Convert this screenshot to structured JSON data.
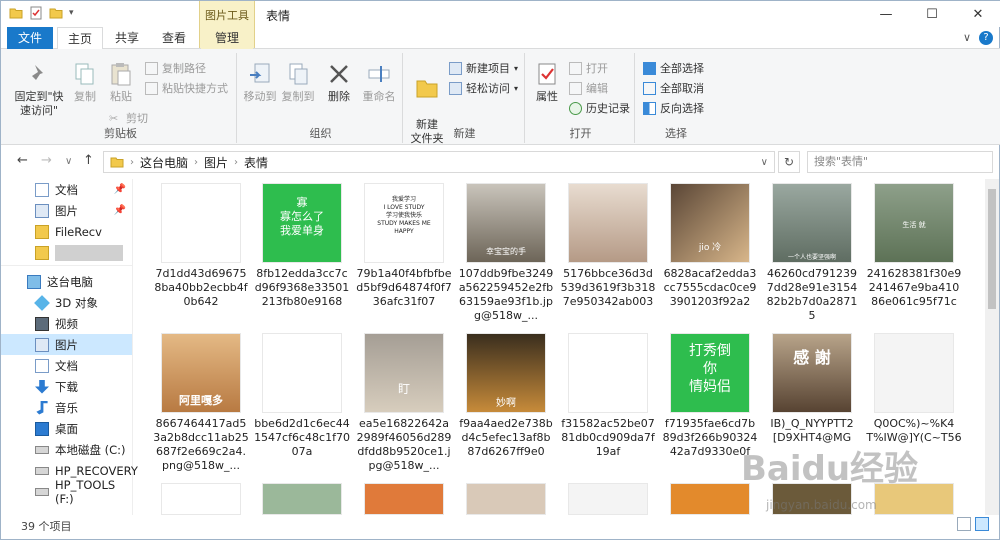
{
  "window": {
    "title": "表情",
    "context_tab_group": "图片工具",
    "minimize": "—",
    "maximize": "☐",
    "close": "✕"
  },
  "tabs": {
    "file": "文件",
    "home": "主页",
    "share": "共享",
    "view": "查看",
    "manage": "管理",
    "expand": "∨",
    "help": "?"
  },
  "ribbon": {
    "clipboard": {
      "label": "剪贴板",
      "pin": "固定到\"快速访问\"",
      "copy": "复制",
      "paste": "粘贴",
      "copy_path": "复制路径",
      "paste_shortcut": "粘贴快捷方式",
      "cut": "剪切"
    },
    "organize": {
      "label": "组织",
      "move_to": "移动到",
      "copy_to": "复制到",
      "delete": "删除",
      "rename": "重命名"
    },
    "new": {
      "label": "新建",
      "new_folder": "新建\n文件夹",
      "new_item": "新建项目",
      "easy_access": "轻松访问"
    },
    "open": {
      "label": "打开",
      "properties": "属性",
      "open": "打开",
      "edit": "编辑",
      "history": "历史记录"
    },
    "select": {
      "label": "选择",
      "select_all": "全部选择",
      "select_none": "全部取消",
      "invert": "反向选择"
    }
  },
  "nav": {
    "back": "←",
    "forward": "→",
    "recent": "∨",
    "up": "↑",
    "breadcrumb": [
      "这台电脑",
      "图片",
      "表情"
    ],
    "dropdown": "∨",
    "refresh": "↻",
    "search_placeholder": "搜索\"表情\""
  },
  "sidebar": {
    "items": [
      {
        "label": "文档",
        "icon": "documents-icon",
        "pinned": "📌"
      },
      {
        "label": "图片",
        "icon": "pictures-icon",
        "pinned": "📌"
      },
      {
        "label": "FileRecv",
        "icon": "folder-icon"
      },
      {
        "label": "",
        "icon": "folder-icon"
      },
      {
        "label": "这台电脑",
        "icon": "computer-icon"
      },
      {
        "label": "3D 对象",
        "icon": "3d-objects-icon"
      },
      {
        "label": "视频",
        "icon": "videos-icon"
      },
      {
        "label": "图片",
        "icon": "pictures-icon"
      },
      {
        "label": "文档",
        "icon": "documents-icon"
      },
      {
        "label": "下载",
        "icon": "downloads-icon"
      },
      {
        "label": "音乐",
        "icon": "music-icon"
      },
      {
        "label": "桌面",
        "icon": "desktop-icon"
      },
      {
        "label": "本地磁盘 (C:)",
        "icon": "drive-icon"
      },
      {
        "label": "HP_RECOVERY",
        "icon": "drive-icon"
      },
      {
        "label": "HP_TOOLS (F:)",
        "icon": "drive-icon"
      }
    ]
  },
  "files": [
    {
      "name": "7d1dd43d696758ba40bb2ecbb4f0b642",
      "thumb_text": ""
    },
    {
      "name": "8fb12edda3cc7cd96f9368e33501213fb80e9168",
      "thumb_text": "寡\n寡怎么了\n我爱单身"
    },
    {
      "name": "79b1a40f4bfbfbed5bf9d64874f0f736afc31f07",
      "thumb_text": "我爱学习\nI LOVE STUDY\n学习使我快乐\nSTUDY MAKES ME\nHAPPY"
    },
    {
      "name": "107ddb9fbe3249a562259452e2fb63159ae93f1b.jpg@518w_...",
      "thumb_text": "幸宝宝的手"
    },
    {
      "name": "5176bbce36d3d539d3619f3b3187e950342ab003",
      "thumb_text": ""
    },
    {
      "name": "6828acaf2edda3cc7555cdac0ce93901203f92a2",
      "thumb_text": "jio 冷"
    },
    {
      "name": "46260cd7912397dd28e91e315482b2b7d0a28715",
      "thumb_text": "一个人也要坚强啊"
    },
    {
      "name": "241628381f30e9241467e9ba41086e061c95f71c",
      "thumb_text": "生活 就"
    },
    {
      "name": "8667464417ad53a2b8dcc11ab25687f2e669c2a4.png@518w_...",
      "thumb_text": "阿里嘎多"
    },
    {
      "name": "bbe6d2d1c6ec441547cf6c48c1f7007a",
      "thumb_text": ""
    },
    {
      "name": "ea5e16822642a2989f46056d289dfdd8b9520ce1.jpg@518w_...",
      "thumb_text": "盯"
    },
    {
      "name": "f9aa4aed2e738bd4c5efec13af8b87d6267ff9e0",
      "thumb_text": "妙啊"
    },
    {
      "name": "f31582ac52be0781db0cd909da7f19af",
      "thumb_text": ""
    },
    {
      "name": "f71935fae6cd7b89d3f266b9032442a7d9330e0f",
      "thumb_text": "打秀倒\n你\n情妈侣"
    },
    {
      "name": "IB)_Q_NYYPTT2[D9XHT4@MG",
      "thumb_text": "感 謝"
    },
    {
      "name": "Q0OC%)~%K4T%IW@]Y(C~T56",
      "thumb_text": ""
    }
  ],
  "status": {
    "count": "39 个项目"
  },
  "watermark": {
    "main": "Baidu经验",
    "sub": "jingyan.baidu.com"
  }
}
